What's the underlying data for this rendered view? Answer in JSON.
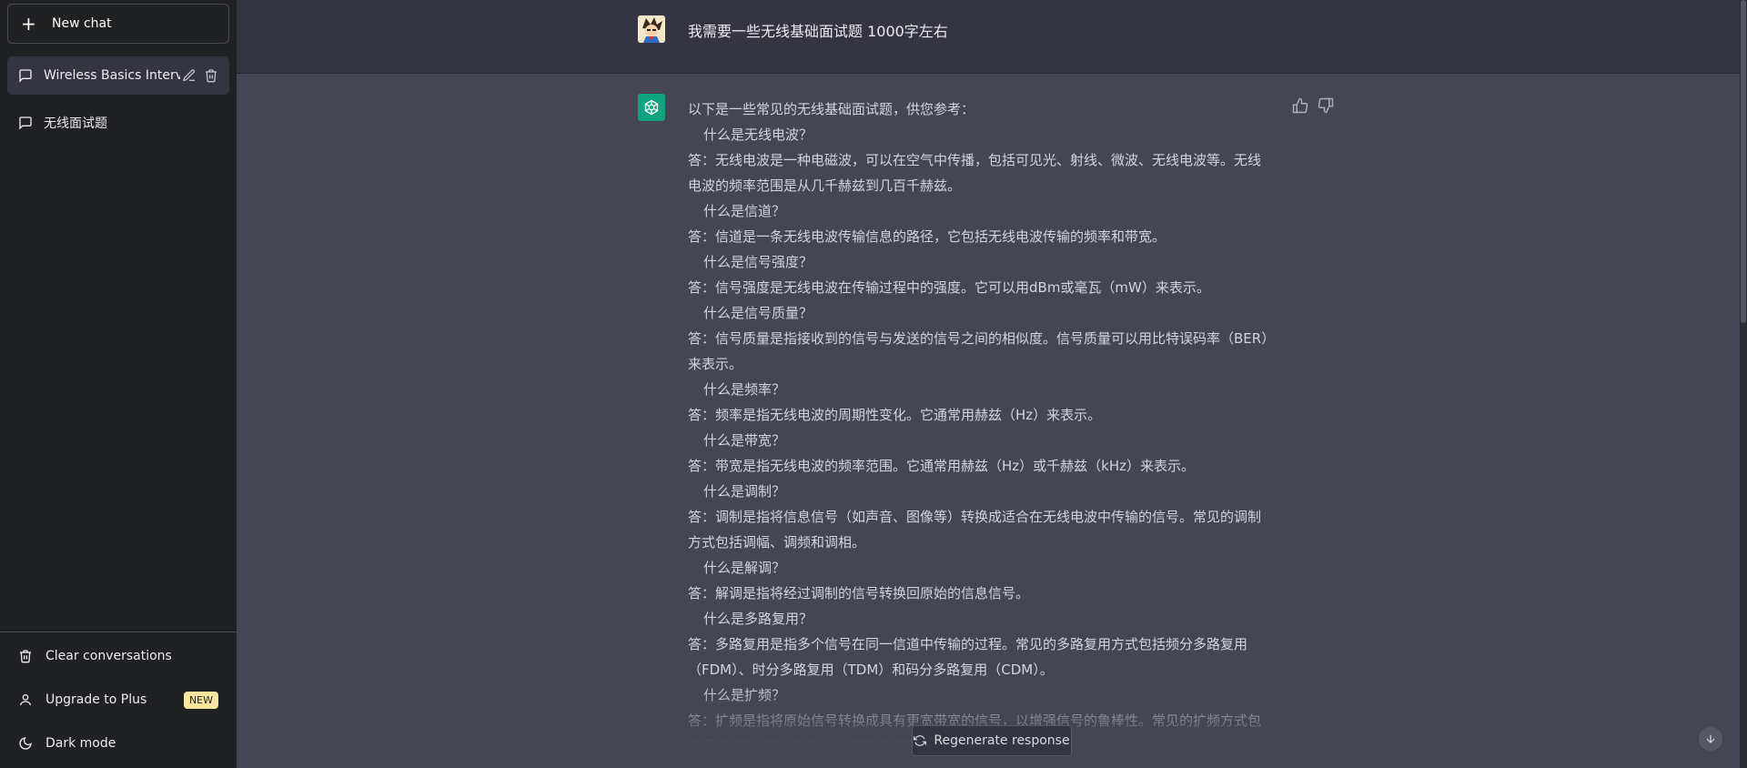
{
  "sidebar": {
    "new_chat": "New chat",
    "conversations": [
      {
        "label": "Wireless Basics Intervie",
        "active": true
      },
      {
        "label": "无线面试题",
        "active": false
      }
    ],
    "bottom": {
      "clear": "Clear conversations",
      "upgrade": "Upgrade to Plus",
      "badge": "NEW",
      "dark_mode": "Dark mode"
    }
  },
  "chat": {
    "user_message": "我需要一些无线基础面试题 1000字左右",
    "answer_lines": [
      {
        "kind": "p",
        "text": "以下是一些常见的无线基础面试题，供您参考："
      },
      {
        "kind": "q",
        "text": "什么是无线电波？"
      },
      {
        "kind": "p",
        "text": "答：无线电波是一种电磁波，可以在空气中传播，包括可见光、射线、微波、无线电波等。无线电波的频率范围是从几千赫兹到几百千赫兹。"
      },
      {
        "kind": "q",
        "text": "什么是信道？"
      },
      {
        "kind": "p",
        "text": "答：信道是一条无线电波传输信息的路径，它包括无线电波传输的频率和带宽。"
      },
      {
        "kind": "q",
        "text": "什么是信号强度？"
      },
      {
        "kind": "p",
        "text": "答：信号强度是无线电波在传输过程中的强度。它可以用dBm或毫瓦（mW）来表示。"
      },
      {
        "kind": "q",
        "text": "什么是信号质量？"
      },
      {
        "kind": "p",
        "text": "答：信号质量是指接收到的信号与发送的信号之间的相似度。信号质量可以用比特误码率（BER）来表示。"
      },
      {
        "kind": "q",
        "text": "什么是频率？"
      },
      {
        "kind": "p",
        "text": "答：频率是指无线电波的周期性变化。它通常用赫兹（Hz）来表示。"
      },
      {
        "kind": "q",
        "text": "什么是带宽？"
      },
      {
        "kind": "p",
        "text": "答：带宽是指无线电波的频率范围。它通常用赫兹（Hz）或千赫兹（kHz）来表示。"
      },
      {
        "kind": "q",
        "text": "什么是调制？"
      },
      {
        "kind": "p",
        "text": "答：调制是指将信息信号（如声音、图像等）转换成适合在无线电波中传输的信号。常见的调制方式包括调幅、调频和调相。"
      },
      {
        "kind": "q",
        "text": "什么是解调？"
      },
      {
        "kind": "p",
        "text": "答：解调是指将经过调制的信号转换回原始的信息信号。"
      },
      {
        "kind": "q",
        "text": "什么是多路复用？"
      },
      {
        "kind": "p",
        "text": "答：多路复用是指多个信号在同一信道中传输的过程。常见的多路复用方式包括频分多路复用（FDM）、时分多路复用（TDM）和码分多路复用（CDM）。"
      },
      {
        "kind": "q",
        "text": "什么是扩频？"
      },
      {
        "kind": "p",
        "text": "答：扩频是指将原始信号转换成具有更宽带宽的信号，以增强信号的鲁棒性。常见的扩频方式包括直接序列扩频（DSSS）和跳频扩频（FHSS）。"
      }
    ],
    "regenerate": "Regenerate response"
  },
  "colors": {
    "sidebar_bg": "#202123",
    "user_row_bg": "#343541",
    "assistant_row_bg": "#444654",
    "gpt_avatar": "#10a37f",
    "badge_bg": "#fae69e"
  }
}
